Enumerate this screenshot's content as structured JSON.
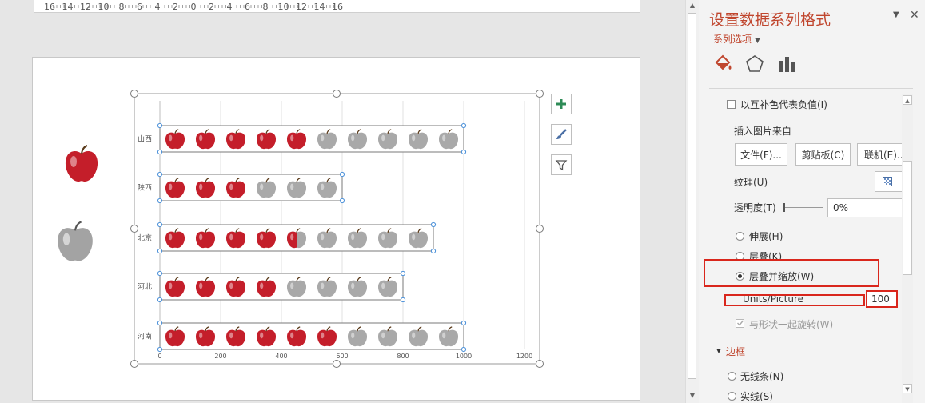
{
  "ruler": {
    "labels": [
      "16",
      "14",
      "12",
      "10",
      "8",
      "6",
      "4",
      "2",
      "0",
      "2",
      "4",
      "6",
      "8",
      "10",
      "12",
      "14",
      "16"
    ]
  },
  "chart_data": {
    "type": "bar",
    "categories": [
      "山西",
      "陕西",
      "北京",
      "河北",
      "河南"
    ],
    "values": [
      1000,
      600,
      900,
      800,
      1000
    ],
    "units_per_picture": 100,
    "xlim": [
      0,
      1200
    ],
    "xticks": [
      "0",
      "200",
      "400",
      "600",
      "800",
      "1000",
      "1200"
    ],
    "grid": true,
    "colors": {
      "full": "#c41e2a",
      "empty": "#a9a9a9"
    }
  },
  "chart_values_filled": [
    5,
    3,
    4.5,
    4,
    6
  ],
  "pane": {
    "title": "设置数据系列格式",
    "series_options": "系列选项",
    "tabs": [
      "fill-line-icon",
      "effects-pentagon-icon",
      "series-options-bar-icon"
    ],
    "invert_if_negative": "以互补色代表负值(I)",
    "insert_from": "插入图片来自",
    "buttons": [
      "文件(F)...",
      "剪贴板(C)",
      "联机(E)..."
    ],
    "texture": "纹理(U)",
    "transparency_label": "透明度(T)",
    "transparency_value": "0%",
    "stretch": "伸展(H)",
    "stack": "层叠(K)",
    "stack_scale": "层叠并缩放(W)",
    "units_label": "Units/Picture",
    "units_value": "100",
    "rotate_with_shape": "与形状一起旋转(W)",
    "border_section": "边框",
    "no_line": "无线条(N)",
    "solid_line": "实线(S)"
  },
  "colors": {
    "accent": "#c0462e",
    "highlight": "#d9261c"
  }
}
